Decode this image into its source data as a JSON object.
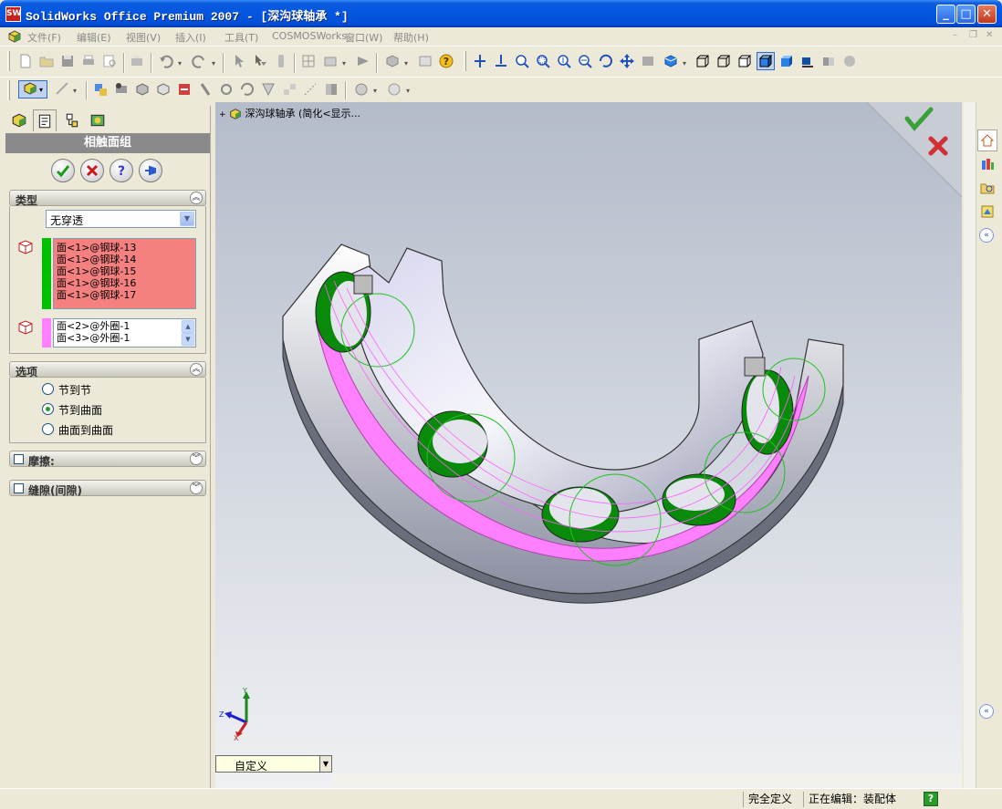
{
  "window": {
    "title": "SolidWorks Office Premium 2007 - [深沟球轴承 *]",
    "app_icon_text": "SW"
  },
  "menu": {
    "items": [
      "文件(F)",
      "编辑(E)",
      "视图(V)",
      "插入(I)",
      "工具(T)",
      "COSMOSWorks",
      "窗口(W)",
      "帮助(H)"
    ]
  },
  "property_manager": {
    "title": "相触面组",
    "groups": {
      "type": {
        "label": "类型",
        "select_value": "无穿透",
        "set1_items": [
          "面<1>@钢球-13",
          "面<1>@钢球-14",
          "面<1>@钢球-15",
          "面<1>@钢球-16",
          "面<1>@钢球-17"
        ],
        "set2_items": [
          "面<2>@外圈-1",
          "面<3>@外圈-1"
        ]
      },
      "options": {
        "label": "选项",
        "radios": [
          "节到节",
          "节到曲面",
          "曲面到曲面"
        ],
        "selected": "节到曲面"
      },
      "friction": {
        "label": "摩擦:"
      },
      "clearance": {
        "label": "缝隙(间隙)"
      }
    }
  },
  "viewport": {
    "breadcrumb": "深沟球轴承  (简化<显示...",
    "display_state": "自定义",
    "triad": {
      "x": "X",
      "y": "Y",
      "z": "Z"
    }
  },
  "status_bar": {
    "state": "完全定义",
    "editing": "正在编辑：装配体"
  },
  "colors": {
    "title_bar": "#0455e0",
    "set1_fill": "#f48080",
    "set1_strip": "#00c000",
    "set2_strip": "#ff80ff",
    "contact_face": "#ff80ff",
    "ball_green": "#0a8a0a"
  }
}
